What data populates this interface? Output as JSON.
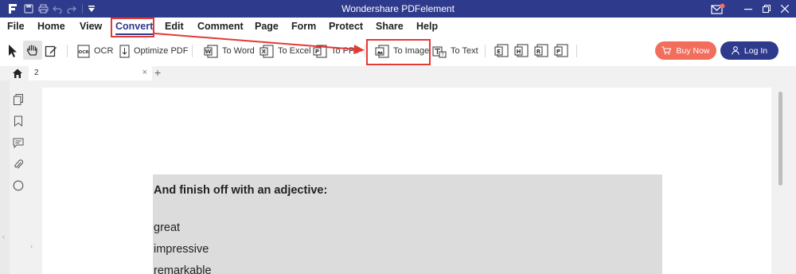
{
  "app": {
    "title": "Wondershare PDFelement"
  },
  "menu": {
    "items": [
      {
        "id": "file",
        "label": "File"
      },
      {
        "id": "home",
        "label": "Home"
      },
      {
        "id": "view",
        "label": "View"
      },
      {
        "id": "convert",
        "label": "Convert",
        "active": true
      },
      {
        "id": "edit",
        "label": "Edit"
      },
      {
        "id": "comment",
        "label": "Comment"
      },
      {
        "id": "page",
        "label": "Page"
      },
      {
        "id": "form",
        "label": "Form"
      },
      {
        "id": "protect",
        "label": "Protect"
      },
      {
        "id": "share",
        "label": "Share"
      },
      {
        "id": "help",
        "label": "Help"
      }
    ]
  },
  "toolbar": {
    "ocr": "OCR",
    "optimize": "Optimize PDF",
    "to_word": "To Word",
    "to_excel": "To Excel",
    "to_ppt": "To PPT",
    "to_image": "To Image",
    "to_text": "To Text",
    "ocr_badge": "OCR",
    "icon_letters": [
      "E",
      "H",
      "R",
      "P"
    ],
    "buy_now": "Buy Now",
    "log_in": "Log In"
  },
  "tabs": {
    "doc_tab": "2",
    "close": "×",
    "add": "+"
  },
  "document": {
    "heading": "And finish off with an adjective:",
    "words": [
      "great",
      "impressive",
      "remarkable"
    ]
  },
  "annotation": {
    "color": "#e53935",
    "target": "To Image"
  },
  "colors": {
    "brand": "#2e3a8c",
    "buy": "#f26d5b",
    "active_tab": "#2e3a8c"
  }
}
